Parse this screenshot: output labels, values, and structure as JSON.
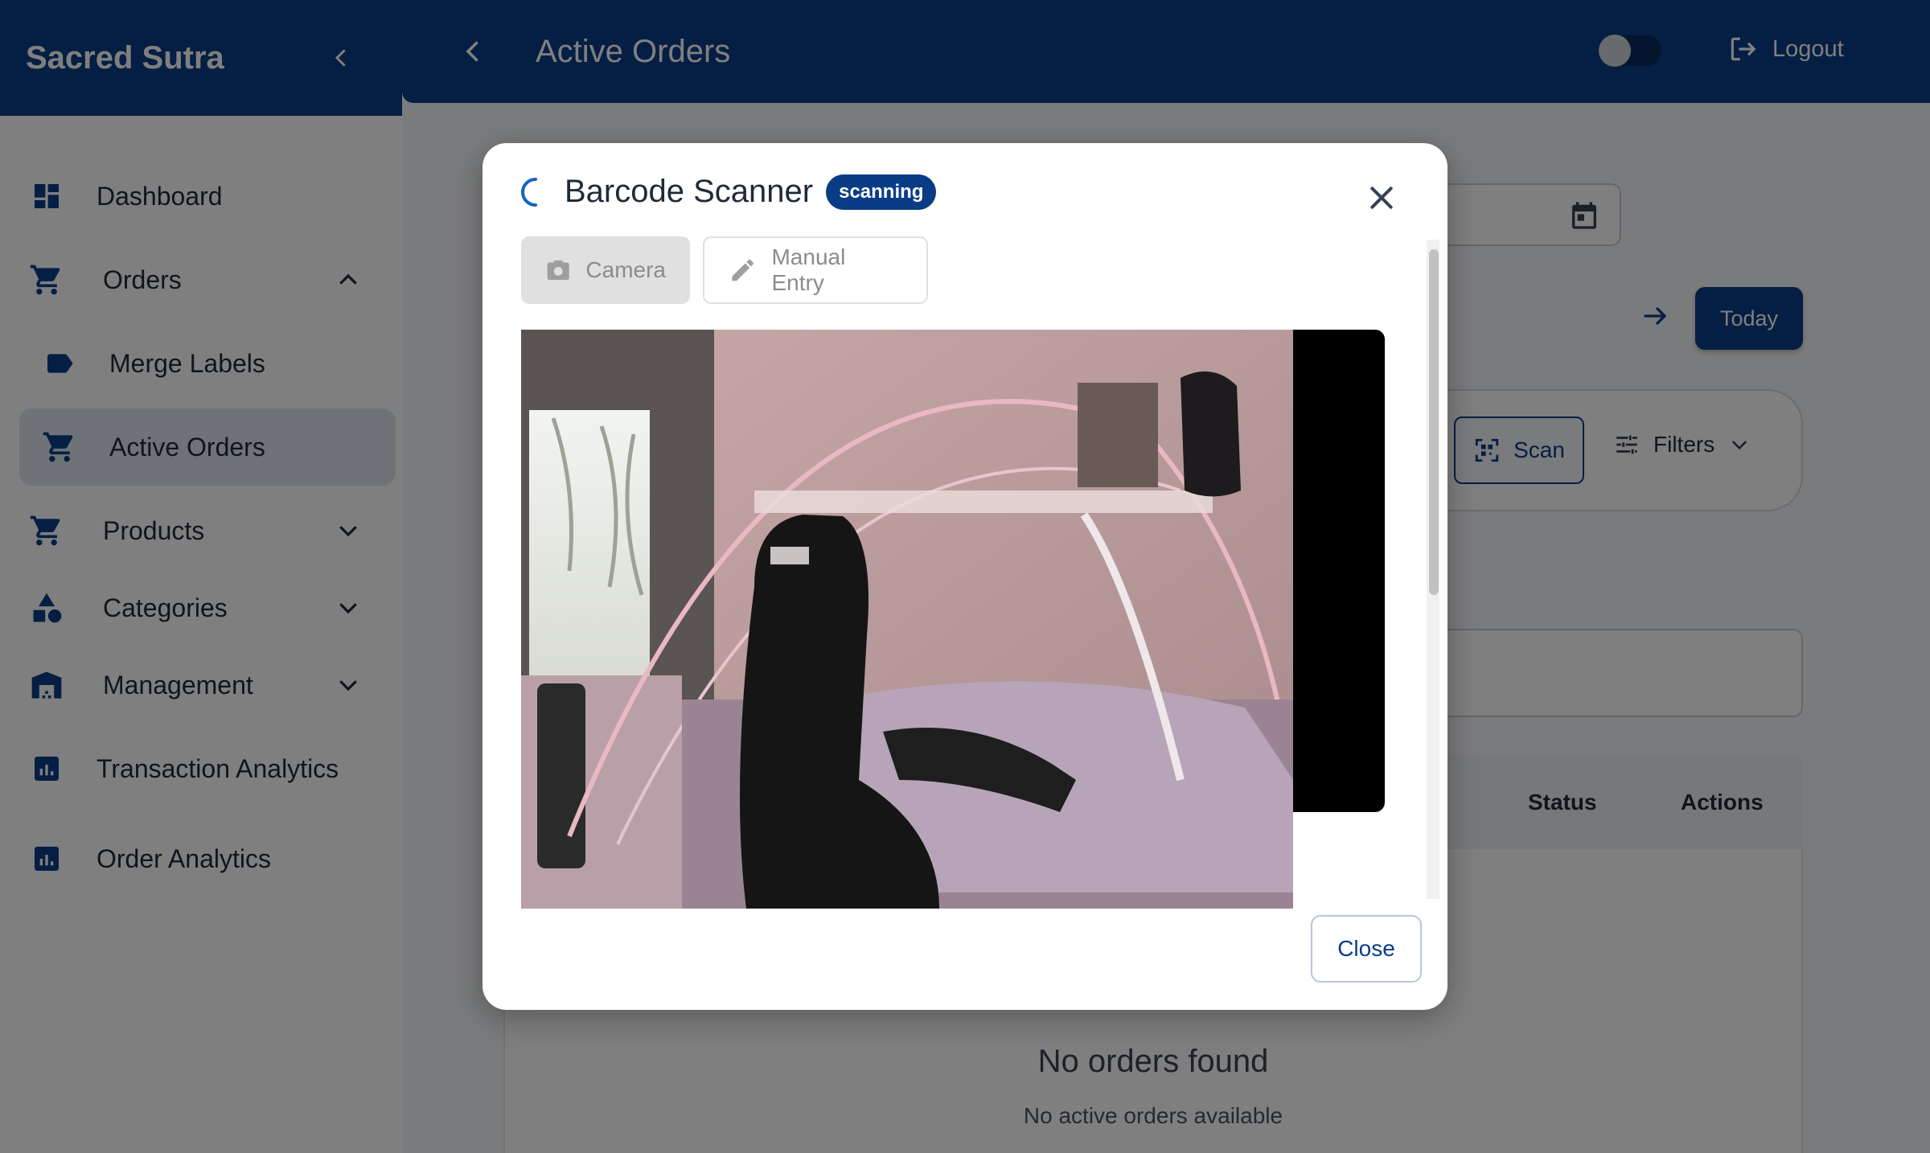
{
  "sidebar": {
    "brand": "Sacred Sutra",
    "items": [
      {
        "label": "Dashboard",
        "icon": "dashboard-icon"
      },
      {
        "label": "Orders",
        "icon": "cart-icon",
        "expanded": true
      },
      {
        "label": "Merge Labels",
        "icon": "label-icon"
      },
      {
        "label": "Active Orders",
        "icon": "cart-icon",
        "active": true
      },
      {
        "label": "Products",
        "icon": "cart-icon"
      },
      {
        "label": "Categories",
        "icon": "category-icon"
      },
      {
        "label": "Management",
        "icon": "warehouse-icon"
      },
      {
        "label": "Transaction Analytics",
        "icon": "analytics-icon"
      },
      {
        "label": "Order Analytics",
        "icon": "analytics-icon"
      }
    ]
  },
  "header": {
    "title": "Active Orders",
    "logout_label": "Logout"
  },
  "toolbar": {
    "today_label": "Today",
    "scan_label": "Scan",
    "filters_label": "Filters"
  },
  "table": {
    "columns": [
      "Status",
      "Actions"
    ],
    "empty_title": "No orders found",
    "empty_subtitle": "No active orders available"
  },
  "modal": {
    "title": "Barcode Scanner",
    "badge": "scanning",
    "camera_label": "Camera",
    "manual_label": "Manual Entry",
    "close_label": "Close"
  },
  "colors": {
    "primary": "#0a3c86",
    "active_nav": "#dfe6f1"
  }
}
